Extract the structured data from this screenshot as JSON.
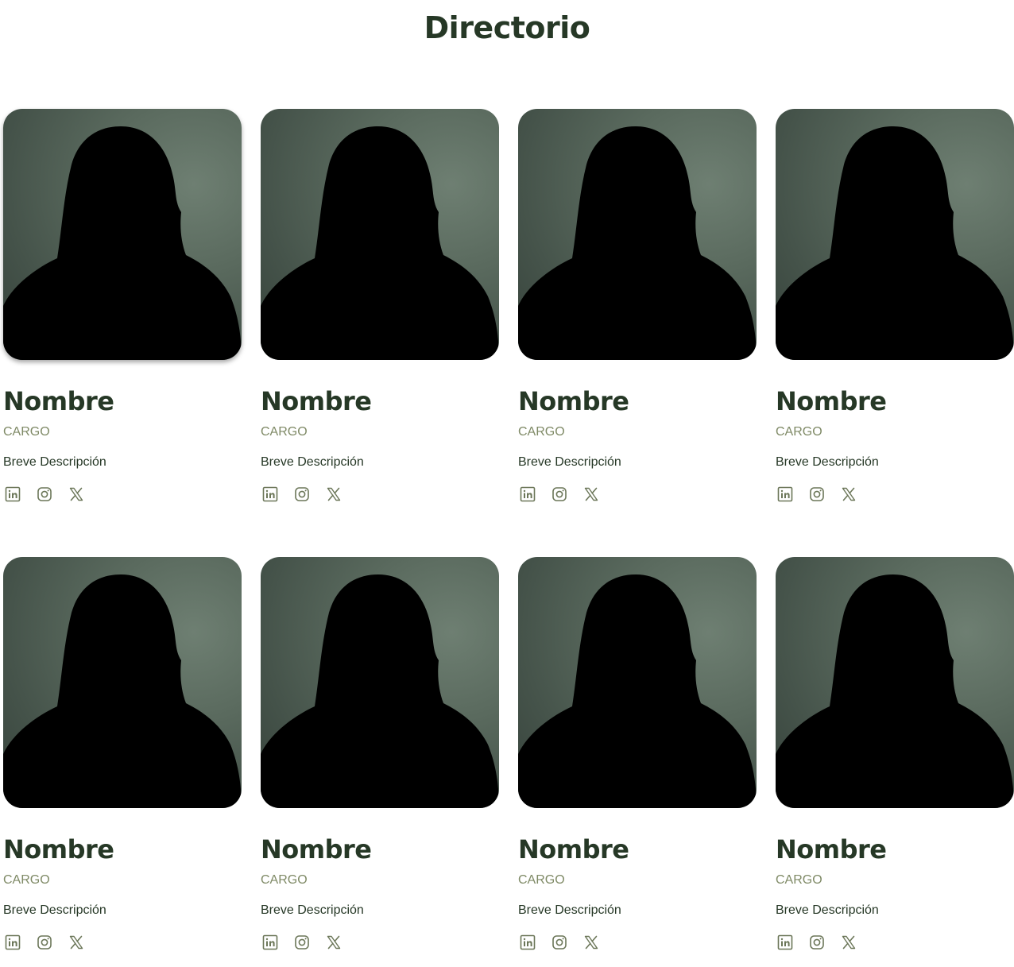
{
  "page": {
    "title": "Directorio"
  },
  "colors": {
    "heading": "#263826",
    "role": "#7f8a66",
    "icon": "#6b7658",
    "photo_background": "#5a6a5e"
  },
  "members": [
    {
      "name": "Nombre",
      "role": "CARGO",
      "description": "Breve Descripción",
      "socials": [
        "linkedin-icon",
        "instagram-icon",
        "x-icon"
      ]
    },
    {
      "name": "Nombre",
      "role": "CARGO",
      "description": "Breve Descripción",
      "socials": [
        "linkedin-icon",
        "instagram-icon",
        "x-icon"
      ]
    },
    {
      "name": "Nombre",
      "role": "CARGO",
      "description": "Breve Descripción",
      "socials": [
        "linkedin-icon",
        "instagram-icon",
        "x-icon"
      ]
    },
    {
      "name": "Nombre",
      "role": "CARGO",
      "description": "Breve Descripción",
      "socials": [
        "linkedin-icon",
        "instagram-icon",
        "x-icon"
      ]
    },
    {
      "name": "Nombre",
      "role": "CARGO",
      "description": "Breve Descripción",
      "socials": [
        "linkedin-icon",
        "instagram-icon",
        "x-icon"
      ]
    },
    {
      "name": "Nombre",
      "role": "CARGO",
      "description": "Breve Descripción",
      "socials": [
        "linkedin-icon",
        "instagram-icon",
        "x-icon"
      ]
    },
    {
      "name": "Nombre",
      "role": "CARGO",
      "description": "Breve Descripción",
      "socials": [
        "linkedin-icon",
        "instagram-icon",
        "x-icon"
      ]
    },
    {
      "name": "Nombre",
      "role": "CARGO",
      "description": "Breve Descripción",
      "socials": [
        "linkedin-icon",
        "instagram-icon",
        "x-icon"
      ]
    }
  ]
}
